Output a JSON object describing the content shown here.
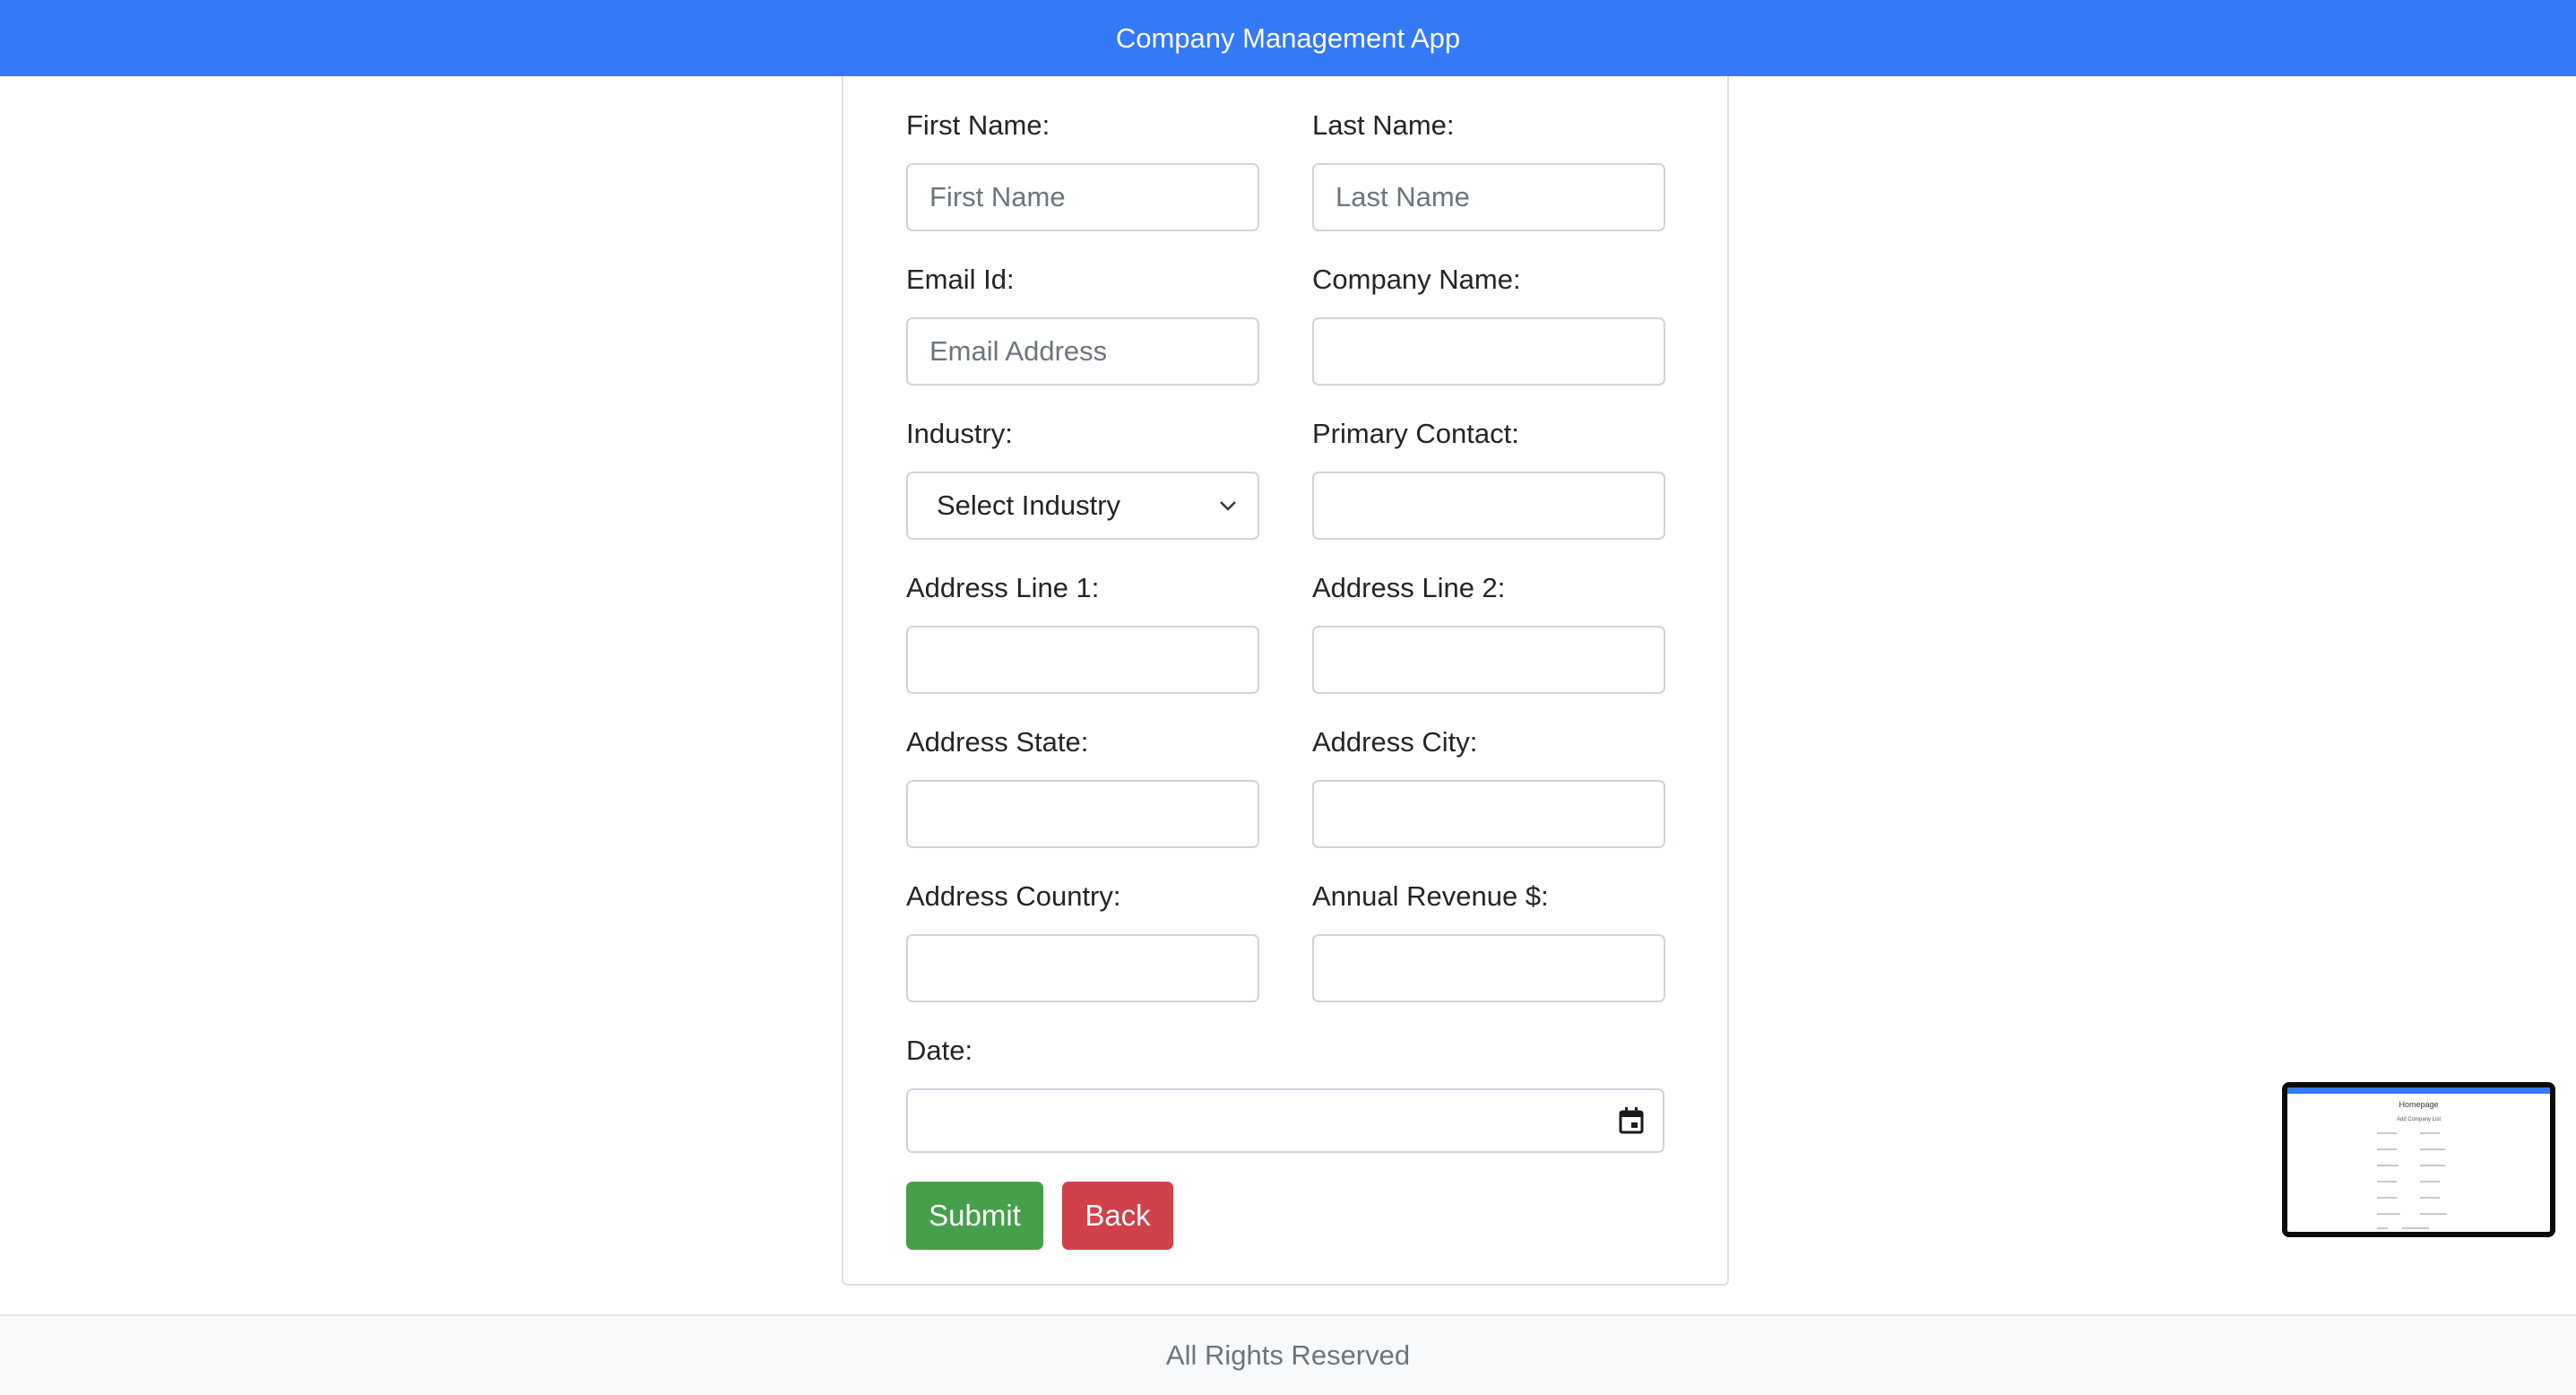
{
  "app": {
    "title": "Company Management App"
  },
  "form": {
    "first_name": {
      "label": "First Name:",
      "placeholder": "First Name"
    },
    "last_name": {
      "label": "Last Name:",
      "placeholder": "Last Name"
    },
    "email": {
      "label": "Email Id:",
      "placeholder": "Email Address"
    },
    "company_name": {
      "label": "Company Name:"
    },
    "industry": {
      "label": "Industry:",
      "selected": "Select Industry",
      "icon": "chevron-down-icon"
    },
    "primary_contact": {
      "label": "Primary Contact:"
    },
    "address_line1": {
      "label": "Address Line 1:"
    },
    "address_line2": {
      "label": "Address Line 2:"
    },
    "address_state": {
      "label": "Address State:"
    },
    "address_city": {
      "label": "Address City:"
    },
    "address_country": {
      "label": "Address Country:"
    },
    "annual_revenue": {
      "label": "Annual Revenue $:"
    },
    "date": {
      "label": "Date:",
      "icon": "calendar-icon"
    },
    "submit_label": "Submit",
    "back_label": "Back"
  },
  "footer": {
    "text": "All Rights Reserved"
  },
  "preview": {
    "title": "Homepage",
    "subtitle": "Add Company List"
  },
  "colors": {
    "navbar": "#3479f6",
    "submit": "#469f4a",
    "back": "#d0414a"
  }
}
